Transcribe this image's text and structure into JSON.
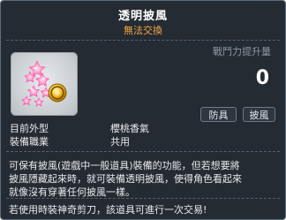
{
  "item": {
    "name": "透明披風",
    "trade_status": "無法交換",
    "icon": "cherry-blossom-cloak-icon",
    "coin_badge": "G"
  },
  "stats": {
    "power_label": "戰鬥力提升量",
    "power_value": "0"
  },
  "tags": [
    "防具",
    "披風"
  ],
  "info": {
    "appearance_label": "目前外型",
    "appearance_value": "櫻桃香氣",
    "job_label": "裝備職業",
    "job_value": "共用"
  },
  "description": "可保有披風(遊戲中一般道具)裝備的功能，但若想要將\n披風隱藏起來時，就可裝備透明披風，使得角色看起來\n就像沒有穿著任何披風一樣。",
  "footer_note": "若使用時裝神奇剪刀，該道具可進行一次交易!",
  "colors": {
    "title": "#ffffff",
    "trade_status": "#f2a641",
    "background": "#1c222a",
    "border": "#5f6d7d",
    "label": "#8c96a0"
  }
}
